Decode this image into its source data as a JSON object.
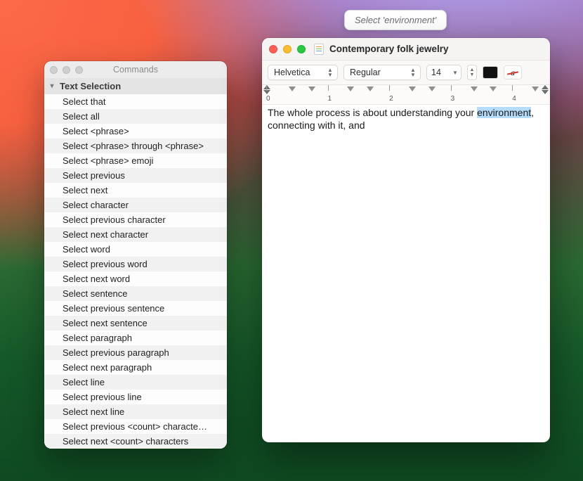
{
  "siri_badge": "Select 'environment'",
  "commands_window": {
    "title": "Commands",
    "section_header": "Text Selection",
    "items": [
      "Select that",
      "Select all",
      "Select <phrase>",
      "Select <phrase> through <phrase>",
      "Select <phrase> emoji",
      "Select previous",
      "Select next",
      "Select character",
      "Select previous character",
      "Select next character",
      "Select word",
      "Select previous word",
      "Select next word",
      "Select sentence",
      "Select previous sentence",
      "Select next sentence",
      "Select paragraph",
      "Select previous paragraph",
      "Select next paragraph",
      "Select line",
      "Select previous line",
      "Select next line",
      "Select previous <count> characte…",
      "Select next <count> characters"
    ]
  },
  "textedit_window": {
    "title": "Contemporary folk jewelry",
    "toolbar": {
      "font_family": "Helvetica",
      "font_weight": "Regular",
      "font_size": "14"
    },
    "ruler": {
      "labels": [
        "0",
        "1",
        "2",
        "3",
        "4"
      ]
    },
    "document": {
      "text_before": "The whole process is about understanding your ",
      "highlighted": "environment",
      "text_after": ", connecting with it, and"
    }
  }
}
